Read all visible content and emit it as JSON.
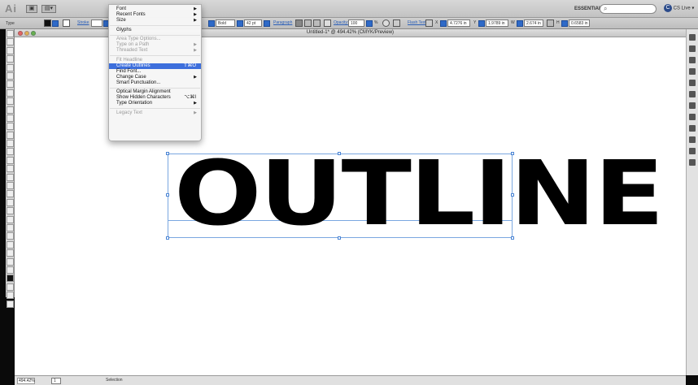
{
  "app": {
    "logo": "Ai",
    "workspace": "ESSENTIALS ▾",
    "search_placeholder": "⌕",
    "cs_live": "CS Live ▾"
  },
  "control_bar": {
    "type_label": "Type",
    "stroke_label": "Stroke",
    "font_style": "Bold",
    "font_size": "42 pt",
    "paragraph_label": "Paragraph",
    "opacity_label": "Opacity:",
    "opacity_value": "100",
    "opacity_unit": "%",
    "flash_text_label": "Flash Text",
    "x_label": "X",
    "x_value": "4.7276 in",
    "y_label": "Y",
    "y_value": "1.9789 in",
    "w_label": "W",
    "w_value": "2.674 in",
    "h_label": "H",
    "h_value": "0.6583 in"
  },
  "document": {
    "title": "Untitled-1* @ 494.42% (CMYK/Preview)",
    "artwork_text": "OUTLINE"
  },
  "status_bar": {
    "zoom": "494.42%",
    "page": "1",
    "tool": "Selection"
  },
  "menu": {
    "items": [
      {
        "label": "Font",
        "arrow": "▶"
      },
      {
        "label": "Recent Fonts",
        "arrow": "▶"
      },
      {
        "label": "Size",
        "arrow": "▶"
      },
      {
        "label": "Glyphs"
      },
      {
        "label": "Area Type Options..."
      },
      {
        "label": "Type on a Path",
        "arrow": "▶"
      },
      {
        "label": "Threaded Text",
        "arrow": "▶"
      },
      {
        "label": "Fit Headline"
      },
      {
        "label": "Create Outlines",
        "shortcut": "⇧⌘O"
      },
      {
        "label": "Find Font..."
      },
      {
        "label": "Change Case",
        "arrow": "▶"
      },
      {
        "label": "Smart Punctuation..."
      },
      {
        "label": "Optical Margin Alignment"
      },
      {
        "label": "Show Hidden Characters",
        "shortcut": "⌥⌘I"
      },
      {
        "label": "Type Orientation",
        "arrow": "▶"
      },
      {
        "label": "Legacy Text",
        "arrow": "▶"
      }
    ]
  },
  "colors": {
    "menu_highlight": "#3d6fdc",
    "selection": "#4a84d4",
    "artwork": "#000000"
  }
}
